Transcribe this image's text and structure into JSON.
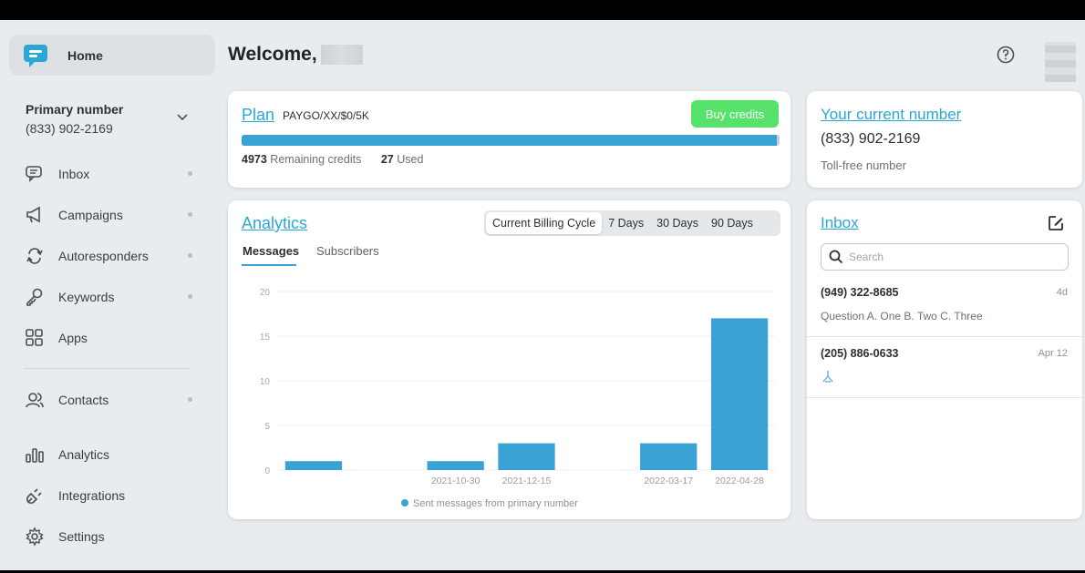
{
  "sidebar": {
    "home_label": "Home",
    "primary_title": "Primary number",
    "primary_number": "(833) 902-2169",
    "items": [
      {
        "label": "Inbox"
      },
      {
        "label": "Campaigns"
      },
      {
        "label": "Autoresponders"
      },
      {
        "label": "Keywords"
      },
      {
        "label": "Apps"
      },
      {
        "label": "Contacts"
      },
      {
        "label": "Analytics"
      },
      {
        "label": "Integrations"
      },
      {
        "label": "Settings"
      }
    ]
  },
  "header": {
    "welcome": "Welcome,"
  },
  "plan": {
    "link": "Plan",
    "code": "PAYGO/XX/$0/5K",
    "buy_label": "Buy credits",
    "remaining_value": "4973",
    "remaining_label": "Remaining credits",
    "used_value": "27",
    "used_label": "Used",
    "remaining_fraction": 0.995
  },
  "current_number": {
    "link": "Your current number",
    "number": "(833) 902-2169",
    "type": "Toll-free number"
  },
  "analytics": {
    "link": "Analytics",
    "ranges": [
      "Current Billing Cycle",
      "7 Days",
      "30 Days",
      "90 Days"
    ],
    "active_range": "Current Billing Cycle",
    "tabs": [
      "Messages",
      "Subscribers"
    ],
    "active_tab": "Messages"
  },
  "chart_data": {
    "type": "bar",
    "categories": [
      "",
      "",
      "2021-10-30",
      "2021-12-15",
      "",
      "2022-03-17",
      "2022-04-28"
    ],
    "values": [
      1,
      0,
      1,
      3,
      0,
      3,
      17
    ],
    "xticks": [
      "2021-10-30",
      "2021-12-15",
      "2022-03-17",
      "2022-04-28"
    ],
    "yticks": [
      0,
      5,
      10,
      15,
      20
    ],
    "ylim": [
      0,
      20
    ],
    "legend": [
      "Sent messages from primary number"
    ],
    "legend_position": "bottom",
    "bar_color": "#3ba2d6"
  },
  "inbox": {
    "link": "Inbox",
    "search_placeholder": "Search",
    "messages": [
      {
        "from": "(949) 322-8685",
        "time": "4d",
        "preview": "Question A. One B. Two C. Three"
      },
      {
        "from": "(205) 886-0633",
        "time": "Apr 12",
        "preview": ""
      }
    ]
  },
  "colors": {
    "accent": "#2ba7d6",
    "buy_button": "#57e26b",
    "progress": "#3ba2d6"
  }
}
